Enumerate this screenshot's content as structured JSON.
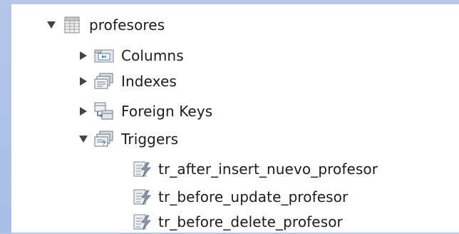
{
  "tree": {
    "table": {
      "label": "profesores",
      "icon": "table-icon",
      "expanded": true
    },
    "columns": {
      "label": "Columns",
      "icon": "columns-folder-icon",
      "expanded": false
    },
    "indexes": {
      "label": "Indexes",
      "icon": "indexes-folder-icon",
      "expanded": false
    },
    "foreign_keys": {
      "label": "Foreign Keys",
      "icon": "foreign-keys-folder-icon",
      "expanded": false
    },
    "triggers": {
      "label": "Triggers",
      "icon": "triggers-folder-icon",
      "expanded": true,
      "items": [
        {
          "label": "tr_after_insert_nuevo_profesor",
          "icon": "trigger-icon"
        },
        {
          "label": "tr_before_update_profesor",
          "icon": "trigger-icon"
        },
        {
          "label": "tr_before_delete_profesor",
          "icon": "trigger-icon"
        }
      ]
    }
  },
  "colors": {
    "background": "#b0c3e7",
    "panel": "#ffffff",
    "text": "#1c1c1c",
    "arrow": "#444444"
  }
}
